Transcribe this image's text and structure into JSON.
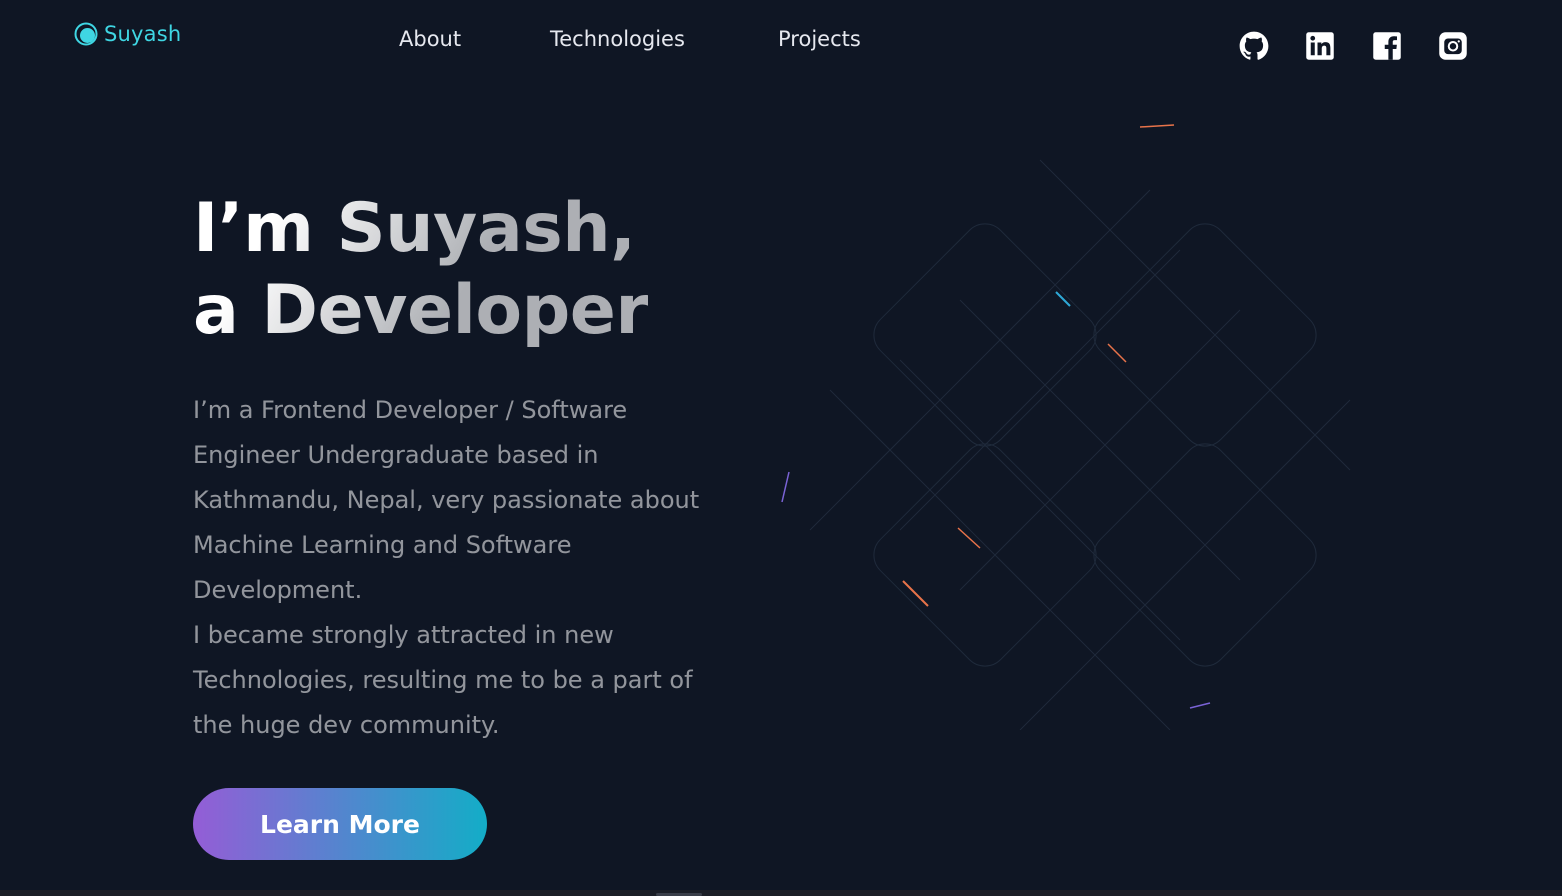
{
  "header": {
    "logo_text": "Suyash",
    "logo_icon": "circle-logo-icon",
    "nav": {
      "about": "About",
      "technologies": "Technologies",
      "projects": "Projects"
    },
    "social": [
      {
        "name": "github",
        "icon": "github-icon"
      },
      {
        "name": "linkedin",
        "icon": "linkedin-icon"
      },
      {
        "name": "facebook",
        "icon": "facebook-icon"
      },
      {
        "name": "instagram",
        "icon": "instagram-icon"
      }
    ]
  },
  "hero": {
    "title_line1": "I’m Suyash,",
    "title_line2": "a Developer",
    "desc_lines": [
      "I’m a Frontend Developer / Software",
      "Engineer Undergraduate based in",
      "Kathmandu, Nepal, very passionate about",
      "Machine Learning and Software",
      "Development.",
      "I became strongly attracted in new",
      "Technologies, resulting me to be a part of",
      "the huge dev community."
    ],
    "cta_label": "Learn More"
  },
  "colors": {
    "background": "#0f1624",
    "accent": "#3fd6e3",
    "nav_text": "#e6e8ef",
    "button_gradient_start": "#945dd6",
    "button_gradient_end": "#13adc7"
  }
}
